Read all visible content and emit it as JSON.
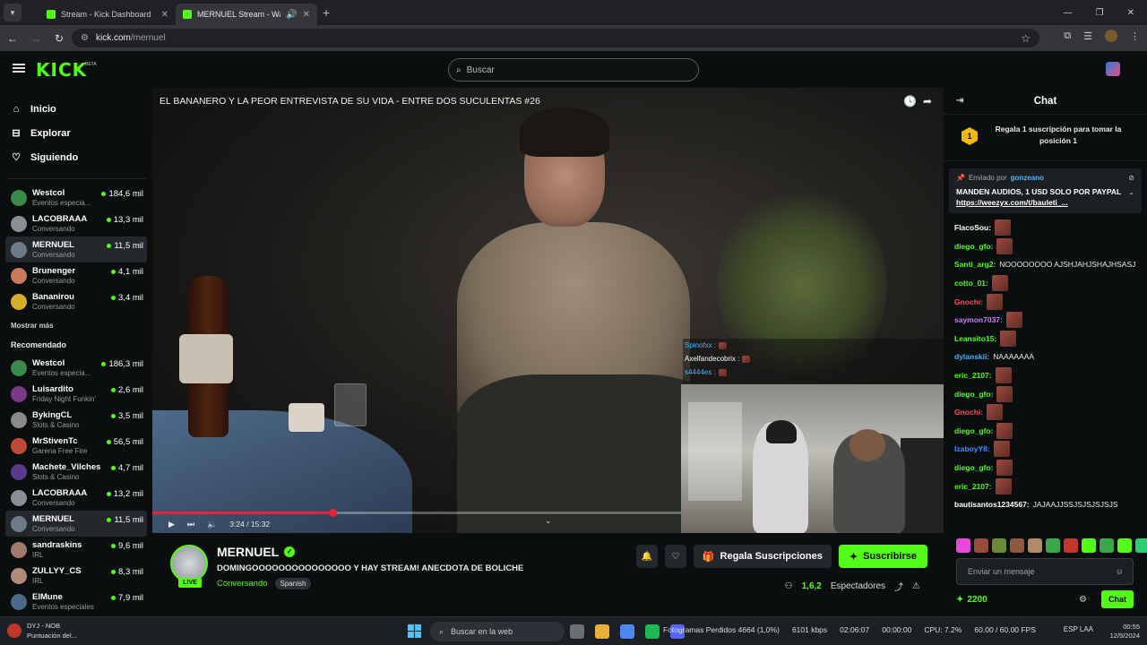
{
  "browser": {
    "tabs": [
      {
        "title": "Stream - Kick Dashboard"
      },
      {
        "title": "MERNUEL Stream - Watch L"
      }
    ],
    "url_host": "kick.com",
    "url_path": "/mernuel"
  },
  "header": {
    "logo": "KICK",
    "beta": "BETA",
    "search_placeholder": "Buscar"
  },
  "sidebar": {
    "nav": [
      {
        "label": "Inicio",
        "icon": "home-icon"
      },
      {
        "label": "Explorar",
        "icon": "explore-icon"
      },
      {
        "label": "Siguiendo",
        "icon": "heart-icon"
      }
    ],
    "following": [
      {
        "name": "Westcol",
        "category": "Eventos especia...",
        "viewers": "184,6 mil",
        "color": "#3a8a4a"
      },
      {
        "name": "LACOBRAAA",
        "category": "Conversando",
        "viewers": "13,3 mil",
        "color": "#8a8f95"
      },
      {
        "name": "MERNUEL",
        "category": "Conversando",
        "viewers": "11,5 mil",
        "color": "#6c7a8a",
        "active": true
      },
      {
        "name": "Brunenger",
        "category": "Conversando",
        "viewers": "4,1 mil",
        "color": "#c87a5a"
      },
      {
        "name": "Bananirou",
        "category": "Conversando",
        "viewers": "3,4 mil",
        "color": "#d4b02a"
      }
    ],
    "show_more": "Mostrar más",
    "recommended_title": "Recomendado",
    "recommended": [
      {
        "name": "Westcol",
        "category": "Eventos especia...",
        "viewers": "186,3 mil",
        "color": "#3a8a4a"
      },
      {
        "name": "Luisardito",
        "category": "Friday Night Funkin'",
        "viewers": "2,6 mil",
        "color": "#7a3a8a"
      },
      {
        "name": "BykingCL",
        "category": "Slots & Casino",
        "viewers": "3,5 mil",
        "color": "#8a8a8a"
      },
      {
        "name": "MrStivenTc",
        "category": "Garena Free Fire",
        "viewers": "56,5 mil",
        "color": "#c04a3a"
      },
      {
        "name": "Machete_Vilches",
        "category": "Slots & Casino",
        "viewers": "4,7 mil",
        "color": "#5a3a8a"
      },
      {
        "name": "LACOBRAAA",
        "category": "Conversando",
        "viewers": "13,2 mil",
        "color": "#8a8f95"
      },
      {
        "name": "MERNUEL",
        "category": "Conversando",
        "viewers": "11,5 mil",
        "color": "#6c7a8a",
        "active": true
      },
      {
        "name": "sandraskins",
        "category": "IRL",
        "viewers": "9,6 mil",
        "color": "#a07a6a"
      },
      {
        "name": "ZULLYY_CS",
        "category": "IRL",
        "viewers": "8,3 mil",
        "color": "#b08a7a"
      },
      {
        "name": "ElMune",
        "category": "Eventos especiales",
        "viewers": "7,9 mil",
        "color": "#4a6a8a"
      }
    ]
  },
  "player": {
    "title": "EL BANANERO Y LA PEOR ENTREVISTA DE SU VIDA - ENTRE DOS SUCULENTAS #26",
    "time": "3:24 / 15:32",
    "progress": 0.34,
    "overlay_chat": [
      {
        "user": "Spinofxx :",
        "color": "#4ab3ff"
      },
      {
        "user": "Axelfandecobrix :",
        "color": "#ffffff"
      },
      {
        "user": "s4444es :",
        "color": "#4ab3ff"
      }
    ]
  },
  "stream": {
    "name": "MERNUEL",
    "live": "LIVE",
    "title": "DOMINGOOOOOOOOOOOOOOO Y HAY STREAM! ANECDOTA DE BOLICHE",
    "category": "Conversando",
    "language": "Spanish",
    "gift_label": "Regala Suscripciones",
    "subscribe_label": "Suscribirse",
    "viewers": "1,6,2",
    "viewers_label": "Espectadores"
  },
  "chat": {
    "title": "Chat",
    "leaderboard_rank": "1",
    "leaderboard_text": "Regala 1 suscripción para tomar la posición 1",
    "pinned_by_label": "Enviado por",
    "pinned_user": "gonzeano",
    "pinned_message": "MANDEN AUDIOS, 1 USD SOLO POR PAYPAL",
    "pinned_link": "https://weezyx.com/t/bauleti_...",
    "messages": [
      {
        "user": "FlacoSou:",
        "color": "#ffffff",
        "text": "",
        "emote": true
      },
      {
        "user": "diego_gfo:",
        "color": "#53fc18",
        "text": "",
        "emote": true
      },
      {
        "user": "Santi_arg2:",
        "color": "#53fc18",
        "text": "NOOOOOOOO AJSHJAHJSHAJHSASJ",
        "emote": false
      },
      {
        "user": "cotto_01:",
        "color": "#53fc18",
        "text": "",
        "emote": true
      },
      {
        "user": "Gnochi:",
        "color": "#ff4d4d",
        "text": "",
        "emote": true
      },
      {
        "user": "saymon7037:",
        "color": "#c77dff",
        "text": "",
        "emote": true
      },
      {
        "user": "Leansito15:",
        "color": "#53fc18",
        "text": "",
        "emote": true
      },
      {
        "user": "dylanskii:",
        "color": "#4ab3ff",
        "text": "NAAAAAAA",
        "emote": false
      },
      {
        "user": "eric_2107:",
        "color": "#53fc18",
        "text": "",
        "emote": true
      },
      {
        "user": "diego_gfo:",
        "color": "#53fc18",
        "text": "",
        "emote": true
      },
      {
        "user": "Gnochi:",
        "color": "#ff4d4d",
        "text": "",
        "emote": true
      },
      {
        "user": "diego_gfo:",
        "color": "#53fc18",
        "text": "",
        "emote": true
      },
      {
        "user": "IzaboyY8:",
        "color": "#4a8aff",
        "text": "",
        "emote": true
      },
      {
        "user": "diego_gfo:",
        "color": "#53fc18",
        "text": "",
        "emote": true
      },
      {
        "user": "eric_2107:",
        "color": "#53fc18",
        "text": "",
        "emote": true
      },
      {
        "user": "bautisantos1234567:",
        "color": "#ffffff",
        "text": "JAJAAJJSSJSJSJSJSJS",
        "emote": false
      }
    ],
    "input_placeholder": "Enviar un mensaje",
    "points": "2200",
    "send_label": "Chat"
  },
  "taskbar": {
    "app_title": "DYJ - NOB",
    "app_sub": "Puntuación del...",
    "search_placeholder": "Buscar en la web",
    "frames_lost": "Fotogramas Perdidos 4664 (1,0%)",
    "bitrate": "6101 kbps",
    "live_time": "02:06:07",
    "rec_time": "00:00:00",
    "cpu": "CPU: 7.2%",
    "fps": "60.00 / 60.00 FPS",
    "lang": "ESP",
    "lang2": "LAA",
    "clock_time": "00:55",
    "clock_date": "12/5/2024"
  }
}
